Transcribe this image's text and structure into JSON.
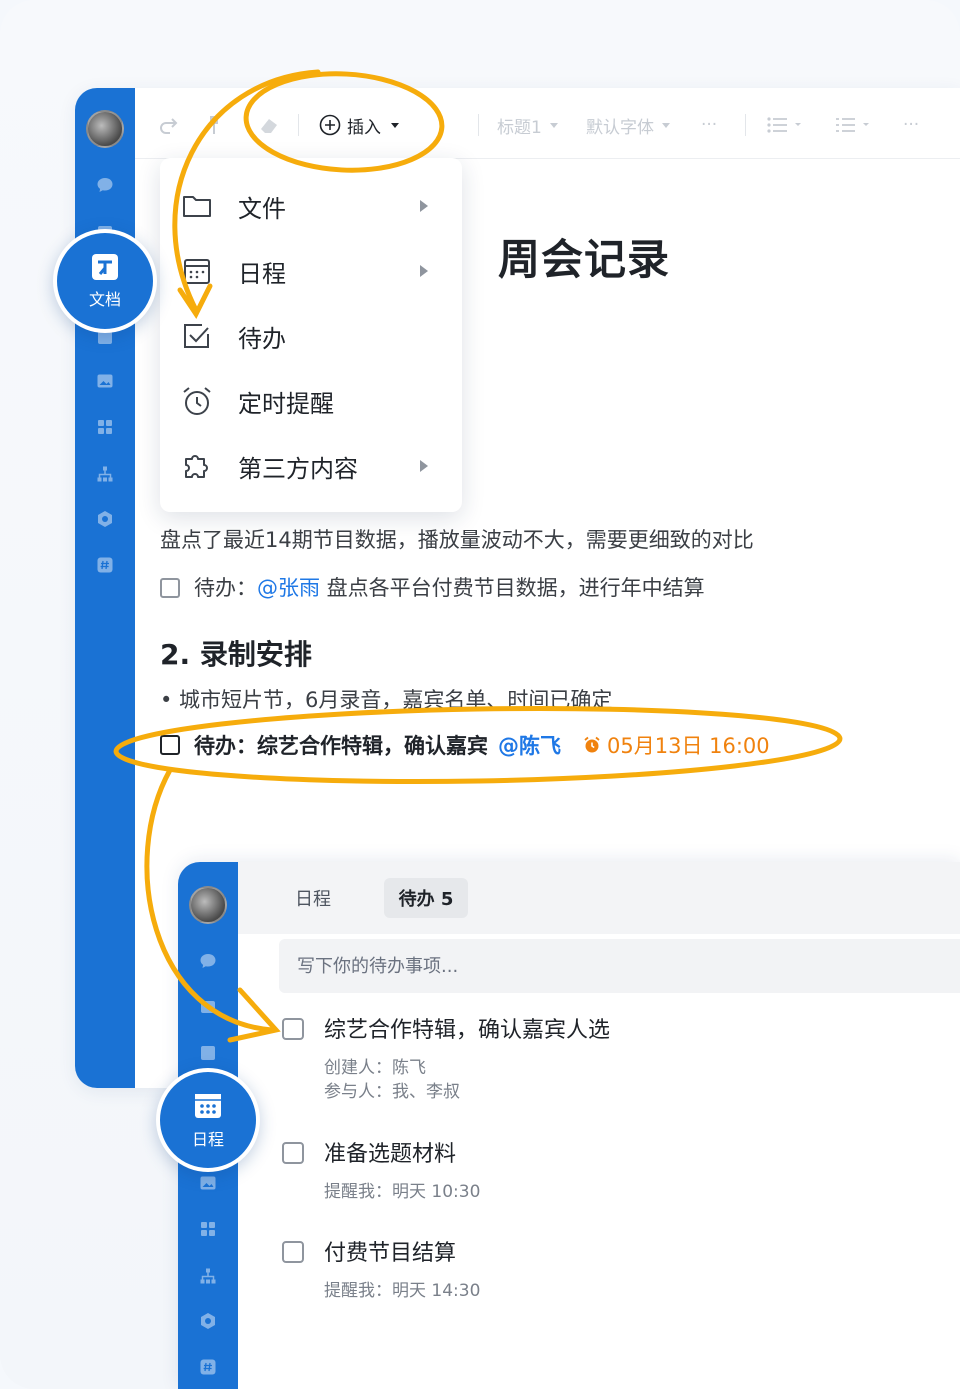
{
  "colors": {
    "accent": "#1a72d4",
    "mention": "#1f78e6",
    "due": "#f0820e",
    "annotation": "#f6ac0c"
  },
  "toolbar": {
    "insert_label": "插入",
    "heading_label": "标题1",
    "font_label": "默认字体",
    "more": "···"
  },
  "document": {
    "title": "周会记录",
    "line1": "盘点了最近14期节目数据，播放量波动不大，需要更细致的对比",
    "todo1_prefix": "待办：",
    "todo1_mention": "@张雨",
    "todo1_text": " 盘点各平台付费节目数据，进行年中结算",
    "heading2": "2. 录制安排",
    "bullet1": "• 城市短片节，6月录音，嘉宾名单、时间已确定",
    "todo2_text": "待办：综艺合作特辑，确认嘉宾",
    "todo2_mention": "@陈飞",
    "todo2_due": "05月13日 16:00"
  },
  "insert_menu": {
    "items": [
      {
        "label": "文件",
        "icon": "folder-icon",
        "submenu": true
      },
      {
        "label": "日程",
        "icon": "calendar-icon",
        "submenu": true
      },
      {
        "label": "待办",
        "icon": "checkbox-icon",
        "submenu": false
      },
      {
        "label": "定时提醒",
        "icon": "alarm-icon",
        "submenu": false
      },
      {
        "label": "第三方内容",
        "icon": "puzzle-icon",
        "submenu": true
      }
    ]
  },
  "badges": {
    "docs": "文档",
    "schedule": "日程"
  },
  "todo_panel": {
    "tab_schedule": "日程",
    "tab_todo": "待办 5",
    "input_placeholder": "写下你的待办事项...",
    "items": [
      {
        "title": "综艺合作特辑，确认嘉宾人选",
        "meta1": "创建人：陈飞",
        "meta2": "参与人：我、李叔"
      },
      {
        "title": "准备选题材料",
        "meta1": "提醒我：明天 10:30"
      },
      {
        "title": "付费节目结算",
        "meta1": "提醒我：明天 14:30"
      }
    ]
  }
}
